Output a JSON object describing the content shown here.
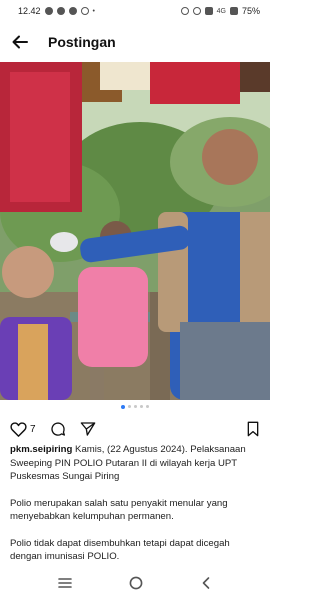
{
  "status_bar": {
    "time": "12.42",
    "network": "4G",
    "battery": "75%"
  },
  "header": {
    "title": "Postingan"
  },
  "post": {
    "carousel_total": 5,
    "carousel_active": 1,
    "likes": "7",
    "username": "pkm.seipiring",
    "caption_line1": "Kamis, (22 Agustus 2024). Pelaksanaan Sweeping PIN POLIO Putaran II di wilayah kerja UPT Puskesmas Sungai Piring",
    "caption_line2": "Polio merupakan salah satu penyakit menular yang menyebabkan kelumpuhan permanen.",
    "caption_line3": "Polio tidak dapat disembuhkan tetapi dapat dicegah dengan imunisasi POLIO."
  },
  "colors": {
    "accent": "#2f7bf5",
    "shirt_blue": "#2f5fb8",
    "shirt_pink": "#f07fa8",
    "shirt_purple": "#6a3fb5",
    "clothes_red": "#c8273a"
  },
  "icons": {
    "back": "arrow-left-icon",
    "like": "heart-icon",
    "comment": "comment-icon",
    "share": "send-icon",
    "save": "bookmark-icon",
    "nav_recent": "recent-apps-icon",
    "nav_home": "home-circle-icon",
    "nav_back": "chevron-left-icon"
  }
}
